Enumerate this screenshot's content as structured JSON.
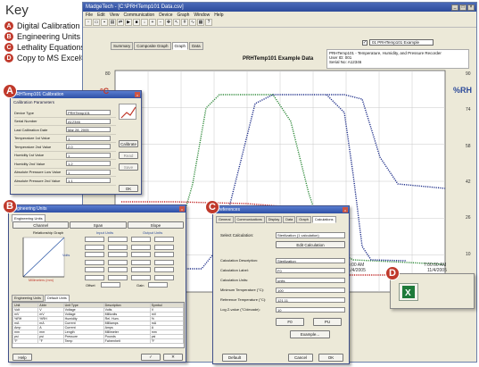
{
  "key": {
    "title": "Key",
    "items": [
      {
        "letter": "A",
        "label": "Digital Calibration"
      },
      {
        "letter": "B",
        "label": "Engineering Units"
      },
      {
        "letter": "C",
        "label": "Lethality Equations"
      },
      {
        "letter": "D",
        "label": "Copy to MS Excel®"
      }
    ]
  },
  "window": {
    "title": "MadgeTech - [C:\\PRHTemp101 Data.csv]",
    "menu": [
      "File",
      "Edit",
      "View",
      "Communication",
      "Device",
      "Graph",
      "Window",
      "Help"
    ],
    "tabs": [
      "Summary",
      "Composite Graph",
      "Graph",
      "Data"
    ],
    "active_tab": "Graph",
    "channel_check": "✓",
    "channel_select": "01   PRHTemp101 Example"
  },
  "graph": {
    "title": "PRHTemp101 Example Data",
    "info_lines": [
      "PRHTemp101 - Temperature, Humidity, and Pressure Recorder",
      "User ID: 001",
      "Serial No: A12346"
    ],
    "left_unit": "°C",
    "right_unit": "%RH",
    "left_ticks": [
      "80",
      "60",
      "40",
      "20",
      "0"
    ],
    "right_ticks": [
      "90",
      "74",
      "58",
      "42",
      "26",
      "10"
    ],
    "x_ticks": [
      "3:24:00 AM",
      "7:00:00 AM"
    ],
    "x_dates": [
      "11/4/2005",
      "11/4/2005"
    ],
    "series_colors": {
      "green": "#2f8a3a",
      "blue": "#1f2f8a",
      "red": "#c02020"
    }
  },
  "dlgA": {
    "badge": "A",
    "title": "PRHTemp101 Calibration",
    "section": "Calibration Parameters",
    "rows": [
      {
        "label": "Device Type",
        "value": "PRHTemp101"
      },
      {
        "label": "Serial Number",
        "value": "A12346"
      },
      {
        "label": "Last Calibration Date",
        "value": "Mar 28, 2005"
      },
      {
        "label": "Temperature 1st Value",
        "value": "1"
      },
      {
        "label": "Temperature 2nd Value",
        "value": "2.0"
      },
      {
        "label": "Humidity 1st Value",
        "value": "1"
      },
      {
        "label": "Humidity 2nd Value",
        "value": "1.2"
      },
      {
        "label": "Absolute Pressure Low Value",
        "value": "1"
      },
      {
        "label": "Absolute Pressure 2nd Value",
        "value": "1.1"
      }
    ],
    "btn_calibrate": "Calibrate",
    "btn_read": "Read",
    "btn_save": "Save",
    "btn_ok": "OK"
  },
  "dlgB": {
    "badge": "B",
    "title": "Engineering Units",
    "tab": "Engineering Units",
    "cols": [
      "Channel",
      "Span",
      "Slope"
    ],
    "sub_tabs": [
      "Engineering Units",
      "Default Units"
    ],
    "graph_label": "Relationship Graph",
    "input_label": "Input Units",
    "output_label": "Output Units",
    "y_axis": "Millimeters (mm)",
    "x_axis": "Volts",
    "offset_label": "Offset",
    "gain_label": "Gain",
    "table_headers": [
      "Unit",
      "Abbr",
      "Unit Type",
      "Description",
      "Symbol"
    ],
    "table_rows": [
      [
        "Volt",
        "V",
        "Voltage",
        "Volts",
        "V"
      ],
      [
        "mV",
        "mV",
        "Voltage",
        "Millivolts",
        "mV"
      ],
      [
        "%RH",
        "%RH",
        "Humidity",
        "Rel. Hum.",
        "%"
      ],
      [
        "mA",
        "mA",
        "Current",
        "Milliamps",
        "mA"
      ],
      [
        "Amp",
        "A",
        "Current",
        "Amps",
        "A"
      ],
      [
        "mm",
        "mm",
        "Length",
        "Millimeter",
        "mm"
      ],
      [
        "psi",
        "psi",
        "Pressure",
        "Pounds",
        "psi"
      ],
      [
        "°F",
        "°F",
        "Temp",
        "Fahrenheit",
        "°F"
      ]
    ],
    "btn_help": "Help"
  },
  "dlgC": {
    "badge": "C",
    "title": "Preferences",
    "tabs": [
      "General",
      "Communications",
      "Display",
      "Data",
      "Graph",
      "Calculations"
    ],
    "active_tab": "Calculations",
    "select_label": "Select Calculation:",
    "select_value": "Sterilization (1 calculation)",
    "edit_btn": "Edit Calculation",
    "fields": [
      {
        "label": "Calculation Description:",
        "value": "Sterilization"
      },
      {
        "label": "Calculation Label:",
        "value": "F0"
      },
      {
        "label": "Calculation Units:",
        "value": "units"
      },
      {
        "label": "Minimum Temperature (°C):",
        "value": "100"
      },
      {
        "label": "Reference Temperature (°C):",
        "value": "121.11"
      },
      {
        "label": "Log Z-value (°C/decade):",
        "value": "10"
      }
    ],
    "btn_f0": "F0",
    "btn_pu": "PU",
    "btn_example": "Example...",
    "btn_default": "Default",
    "btn_cancel": "Cancel",
    "btn_ok": "OK"
  },
  "dlgD": {
    "badge": "D"
  }
}
